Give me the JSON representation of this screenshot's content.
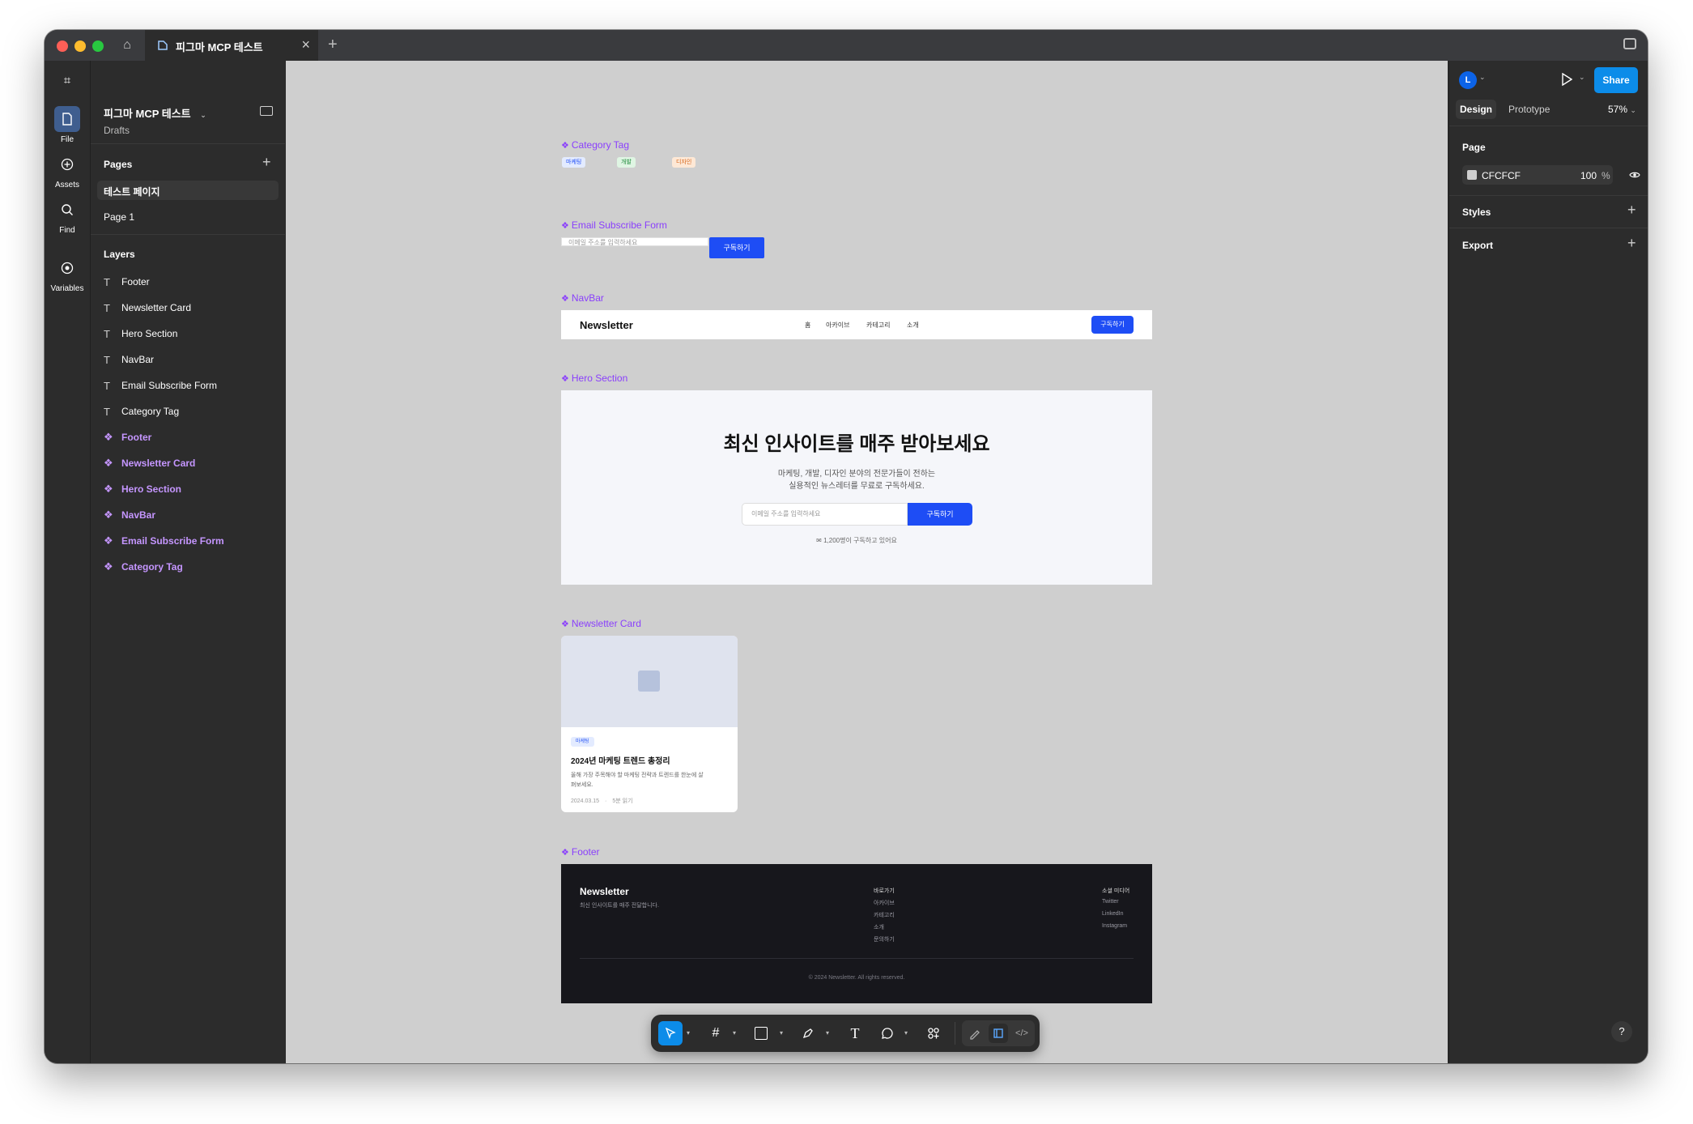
{
  "tab": {
    "title": "피그마 MCP 테스트"
  },
  "rail": {
    "file": "File",
    "assets": "Assets",
    "find": "Find",
    "variables": "Variables"
  },
  "file": {
    "name": "피그마 MCP 테스트",
    "location": "Drafts"
  },
  "pages": {
    "heading": "Pages",
    "items": [
      "테스트 페이지",
      "Page 1"
    ]
  },
  "layers": {
    "heading": "Layers",
    "items": [
      {
        "label": "Footer",
        "kind": "text"
      },
      {
        "label": "Newsletter Card",
        "kind": "text"
      },
      {
        "label": "Hero Section",
        "kind": "text"
      },
      {
        "label": "NavBar",
        "kind": "text"
      },
      {
        "label": "Email Subscribe Form",
        "kind": "text"
      },
      {
        "label": "Category Tag",
        "kind": "text"
      },
      {
        "label": "Footer",
        "kind": "component"
      },
      {
        "label": "Newsletter Card",
        "kind": "component"
      },
      {
        "label": "Hero Section",
        "kind": "component"
      },
      {
        "label": "NavBar",
        "kind": "component"
      },
      {
        "label": "Email Subscribe Form",
        "kind": "component"
      },
      {
        "label": "Category Tag",
        "kind": "component"
      }
    ]
  },
  "canvas": {
    "labels": {
      "category": "Category Tag",
      "email": "Email Subscribe Form",
      "navbar": "NavBar",
      "hero": "Hero Section",
      "card": "Newsletter Card",
      "footer": "Footer"
    },
    "tags": [
      "마케팅",
      "개발",
      "디자인"
    ],
    "email_form": {
      "placeholder": "이메일 주소를 입력하세요",
      "button": "구독하기"
    },
    "navbar": {
      "brand": "Newsletter",
      "links": [
        "홈",
        "아카이브",
        "카테고리",
        "소개"
      ],
      "button": "구독하기"
    },
    "hero": {
      "title": "최신 인사이트를 매주 받아보세요",
      "sub1": "마케팅, 개발, 디자인 분야의 전문가들이 전하는",
      "sub2": "실용적인 뉴스레터를 무료로 구독하세요.",
      "placeholder": "이메일 주소를 입력하세요",
      "button": "구독하기",
      "note": "✉ 1,200명이 구독하고 있어요"
    },
    "card": {
      "tag": "마케팅",
      "title": "2024년 마케팅 트렌드 총정리",
      "desc1": "올해 가장 주목해야 할 마케팅 전략과 트렌드를 한눈에 살",
      "desc2": "펴보세요.",
      "date": "2024.03.15",
      "read": "5분 읽기"
    },
    "footer": {
      "brand": "Newsletter",
      "tagline": "최신 인사이트를 매주 전달합니다.",
      "quick_heading": "바로가기",
      "quick": [
        "아카이브",
        "카테고리",
        "소개",
        "문의하기"
      ],
      "social_heading": "소셜 미디어",
      "social": [
        "Twitter",
        "LinkedIn",
        "Instagram"
      ],
      "copyright": "© 2024 Newsletter. All rights reserved."
    }
  },
  "right": {
    "avatar": "L",
    "share": "Share",
    "tab_design": "Design",
    "tab_prototype": "Prototype",
    "zoom": "57%",
    "page_heading": "Page",
    "page_color": "CFCFCF",
    "page_opacity": "100",
    "pct": "%",
    "styles": "Styles",
    "export": "Export",
    "help": "?"
  },
  "colors": {
    "accent": "#1E4DF5",
    "component": "#8A3FFC",
    "canvas": "#CFCFCF",
    "share": "#0C8CE9"
  }
}
